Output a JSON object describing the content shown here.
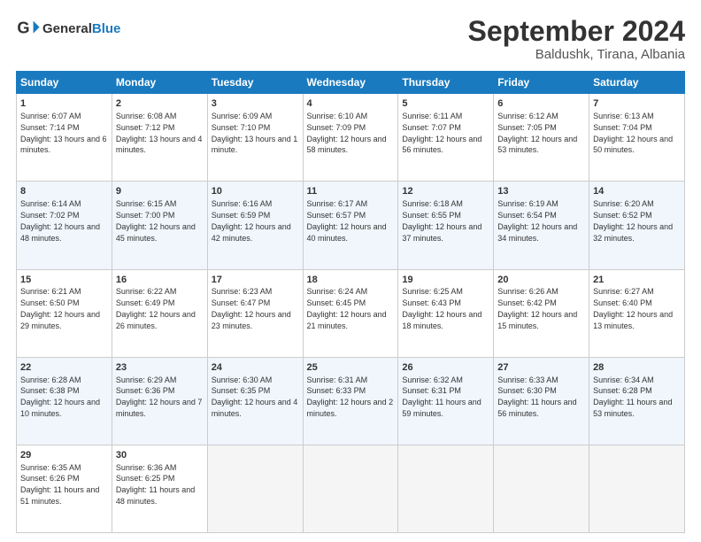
{
  "header": {
    "logo_text_general": "General",
    "logo_text_blue": "Blue",
    "month": "September 2024",
    "location": "Baldushk, Tirana, Albania"
  },
  "calendar": {
    "days_of_week": [
      "Sunday",
      "Monday",
      "Tuesday",
      "Wednesday",
      "Thursday",
      "Friday",
      "Saturday"
    ],
    "weeks": [
      [
        null,
        {
          "day": 2,
          "sunrise": "6:08 AM",
          "sunset": "7:12 PM",
          "daylight": "13 hours and 4 minutes."
        },
        {
          "day": 3,
          "sunrise": "6:09 AM",
          "sunset": "7:10 PM",
          "daylight": "13 hours and 1 minute."
        },
        {
          "day": 4,
          "sunrise": "6:10 AM",
          "sunset": "7:09 PM",
          "daylight": "12 hours and 58 minutes."
        },
        {
          "day": 5,
          "sunrise": "6:11 AM",
          "sunset": "7:07 PM",
          "daylight": "12 hours and 56 minutes."
        },
        {
          "day": 6,
          "sunrise": "6:12 AM",
          "sunset": "7:05 PM",
          "daylight": "12 hours and 53 minutes."
        },
        {
          "day": 7,
          "sunrise": "6:13 AM",
          "sunset": "7:04 PM",
          "daylight": "12 hours and 50 minutes."
        }
      ],
      [
        {
          "day": 1,
          "sunrise": "6:07 AM",
          "sunset": "7:14 PM",
          "daylight": "13 hours and 6 minutes."
        },
        {
          "day": 9,
          "sunrise": "6:15 AM",
          "sunset": "7:00 PM",
          "daylight": "12 hours and 45 minutes."
        },
        {
          "day": 10,
          "sunrise": "6:16 AM",
          "sunset": "6:59 PM",
          "daylight": "12 hours and 42 minutes."
        },
        {
          "day": 11,
          "sunrise": "6:17 AM",
          "sunset": "6:57 PM",
          "daylight": "12 hours and 40 minutes."
        },
        {
          "day": 12,
          "sunrise": "6:18 AM",
          "sunset": "6:55 PM",
          "daylight": "12 hours and 37 minutes."
        },
        {
          "day": 13,
          "sunrise": "6:19 AM",
          "sunset": "6:54 PM",
          "daylight": "12 hours and 34 minutes."
        },
        {
          "day": 14,
          "sunrise": "6:20 AM",
          "sunset": "6:52 PM",
          "daylight": "12 hours and 32 minutes."
        }
      ],
      [
        {
          "day": 8,
          "sunrise": "6:14 AM",
          "sunset": "7:02 PM",
          "daylight": "12 hours and 48 minutes."
        },
        {
          "day": 16,
          "sunrise": "6:22 AM",
          "sunset": "6:49 PM",
          "daylight": "12 hours and 26 minutes."
        },
        {
          "day": 17,
          "sunrise": "6:23 AM",
          "sunset": "6:47 PM",
          "daylight": "12 hours and 23 minutes."
        },
        {
          "day": 18,
          "sunrise": "6:24 AM",
          "sunset": "6:45 PM",
          "daylight": "12 hours and 21 minutes."
        },
        {
          "day": 19,
          "sunrise": "6:25 AM",
          "sunset": "6:43 PM",
          "daylight": "12 hours and 18 minutes."
        },
        {
          "day": 20,
          "sunrise": "6:26 AM",
          "sunset": "6:42 PM",
          "daylight": "12 hours and 15 minutes."
        },
        {
          "day": 21,
          "sunrise": "6:27 AM",
          "sunset": "6:40 PM",
          "daylight": "12 hours and 13 minutes."
        }
      ],
      [
        {
          "day": 15,
          "sunrise": "6:21 AM",
          "sunset": "6:50 PM",
          "daylight": "12 hours and 29 minutes."
        },
        {
          "day": 23,
          "sunrise": "6:29 AM",
          "sunset": "6:36 PM",
          "daylight": "12 hours and 7 minutes."
        },
        {
          "day": 24,
          "sunrise": "6:30 AM",
          "sunset": "6:35 PM",
          "daylight": "12 hours and 4 minutes."
        },
        {
          "day": 25,
          "sunrise": "6:31 AM",
          "sunset": "6:33 PM",
          "daylight": "12 hours and 2 minutes."
        },
        {
          "day": 26,
          "sunrise": "6:32 AM",
          "sunset": "6:31 PM",
          "daylight": "11 hours and 59 minutes."
        },
        {
          "day": 27,
          "sunrise": "6:33 AM",
          "sunset": "6:30 PM",
          "daylight": "11 hours and 56 minutes."
        },
        {
          "day": 28,
          "sunrise": "6:34 AM",
          "sunset": "6:28 PM",
          "daylight": "11 hours and 53 minutes."
        }
      ],
      [
        {
          "day": 22,
          "sunrise": "6:28 AM",
          "sunset": "6:38 PM",
          "daylight": "12 hours and 10 minutes."
        },
        {
          "day": 30,
          "sunrise": "6:36 AM",
          "sunset": "6:25 PM",
          "daylight": "11 hours and 48 minutes."
        },
        null,
        null,
        null,
        null,
        null
      ],
      [
        {
          "day": 29,
          "sunrise": "6:35 AM",
          "sunset": "6:26 PM",
          "daylight": "11 hours and 51 minutes."
        },
        null,
        null,
        null,
        null,
        null,
        null
      ]
    ]
  }
}
